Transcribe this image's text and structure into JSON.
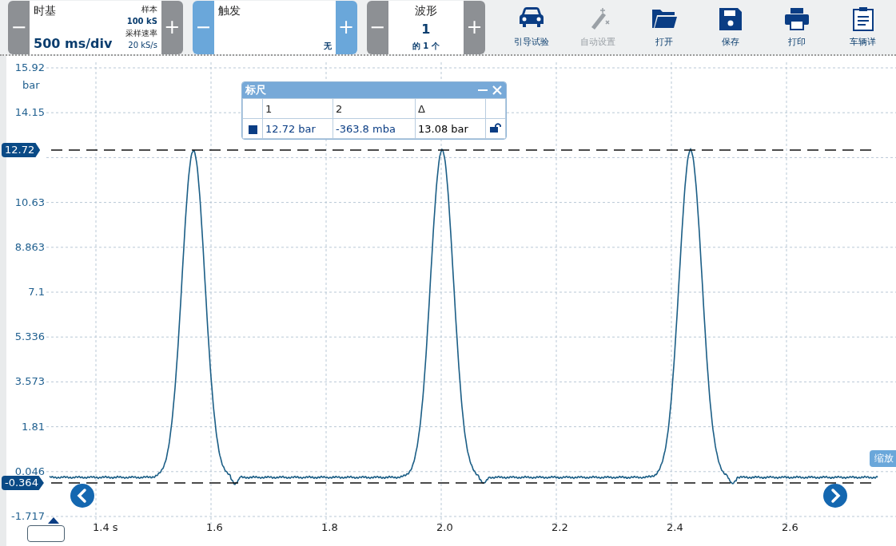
{
  "toolbar": {
    "timebase": {
      "title": "时基",
      "value": "500 ms/div",
      "samples_label": "样本",
      "samples": "100 kS",
      "rate_label": "采样速率",
      "rate": "20 kS/s",
      "minus": "−",
      "plus": "+"
    },
    "trigger": {
      "title": "触发",
      "mode": "无",
      "minus": "−",
      "plus": "+"
    },
    "waveform": {
      "title": "波形",
      "number": "1",
      "count": "的 1 个",
      "minus": "−",
      "plus": "+"
    },
    "actions": [
      {
        "kind": "car",
        "label": "引导试验",
        "disabled": false
      },
      {
        "kind": "wand",
        "label": "自动设置",
        "disabled": true
      },
      {
        "kind": "folder",
        "label": "打开",
        "disabled": false
      },
      {
        "kind": "save",
        "label": "保存",
        "disabled": false
      },
      {
        "kind": "print",
        "label": "打印",
        "disabled": false
      },
      {
        "kind": "clipboard",
        "label": "车辆详",
        "disabled": false
      }
    ]
  },
  "plot": {
    "unit": "bar",
    "y_labels": [
      "15.92",
      "14.15",
      "10.63",
      "8.863",
      "7.1",
      "5.336",
      "3.573",
      "1.81",
      "0.046",
      "-1.717"
    ],
    "x_labels": [
      "1.4 s",
      "1.6",
      "1.8",
      "2.0",
      "2.2",
      "2.4",
      "2.6"
    ],
    "cursors": [
      {
        "label": "12.72"
      },
      {
        "label": "-0.364"
      }
    ],
    "zoom_label": "缩放"
  },
  "ruler": {
    "title": "标尺",
    "columns": [
      "1",
      "2",
      "Δ"
    ],
    "rows": [
      {
        "color": "#0a3d84",
        "values": [
          "12.72 bar",
          "-363.8 mba",
          "13.08 bar"
        ],
        "locked": false
      }
    ]
  }
}
